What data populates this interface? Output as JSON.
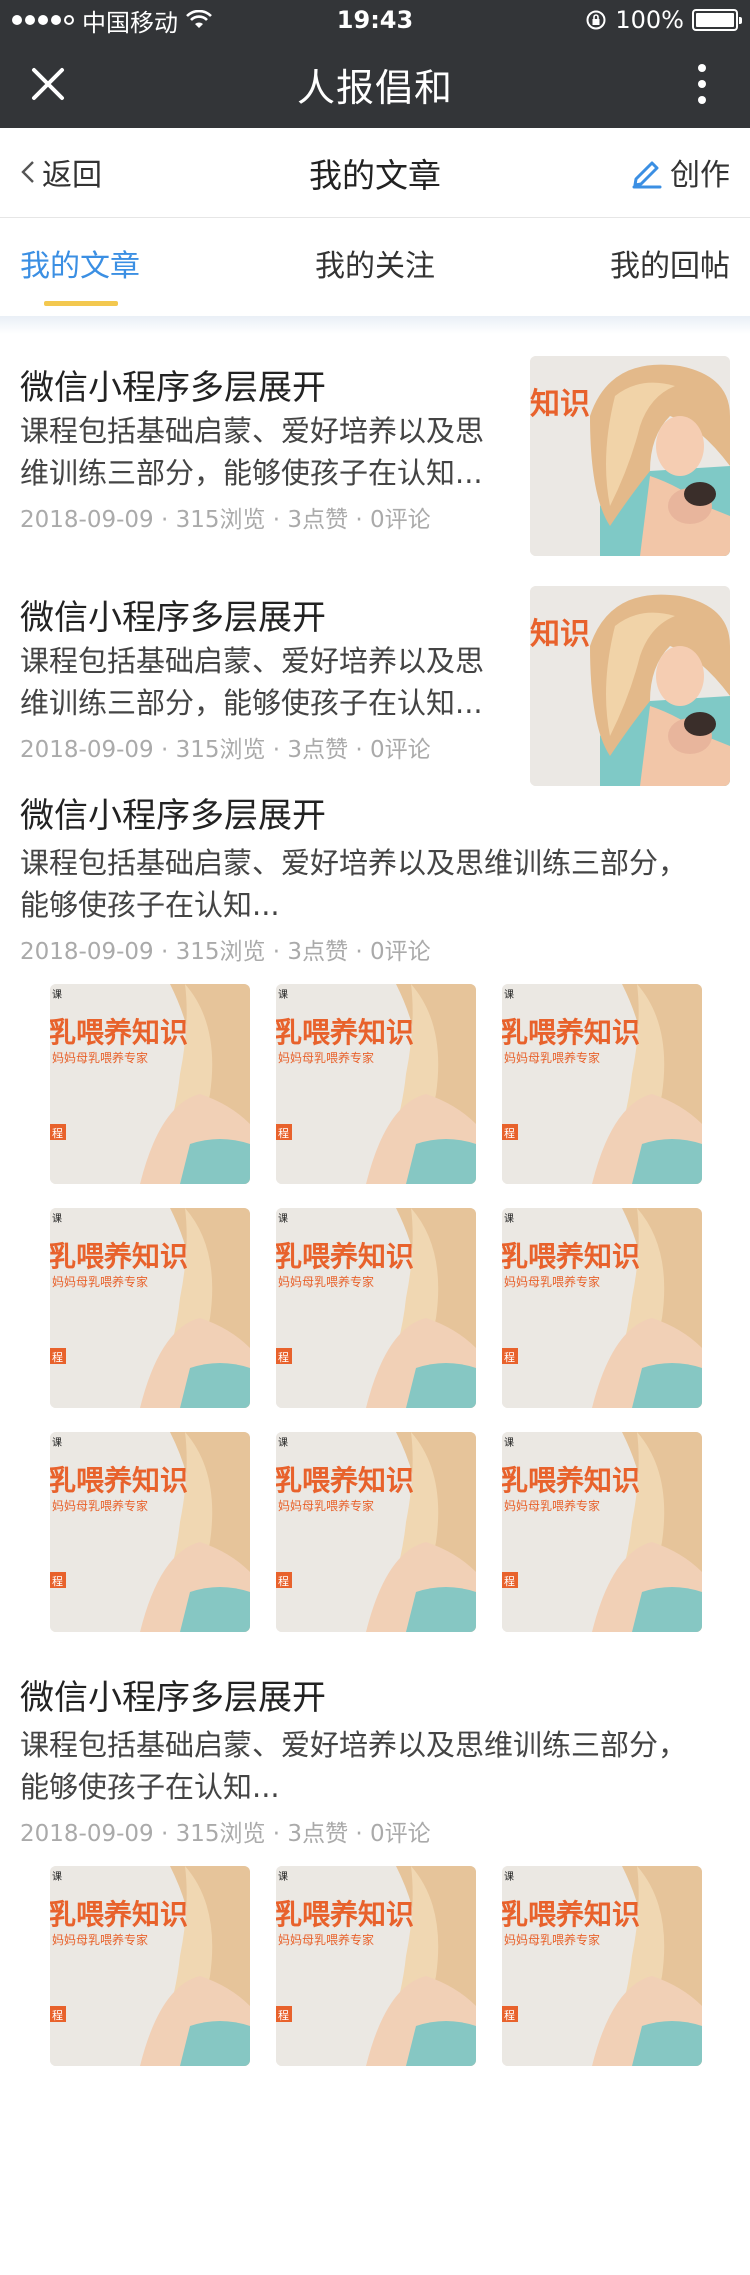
{
  "status_bar": {
    "carrier": "中国移动",
    "time": "19:43",
    "battery": "100%",
    "battery_level": 1.0
  },
  "app": {
    "title": "人报倡和"
  },
  "nav": {
    "back_label": "返回",
    "page_title": "我的文章",
    "create_label": "创作"
  },
  "tabs": [
    {
      "label": "我的文章",
      "active": true
    },
    {
      "label": "我的关注",
      "active": false
    },
    {
      "label": "我的回帖",
      "active": false
    }
  ],
  "colors": {
    "accent": "#3b8fe3",
    "tab_indicator": "#f3c84f",
    "header_bg": "#333538",
    "thumb_text": "#e8622c"
  },
  "thumb_single": {
    "text": "知识"
  },
  "thumb_grid": {
    "line1": "乳喂养知识",
    "line2": "妈妈母乳喂养专家",
    "tag": "程",
    "corner": "课"
  },
  "articles": [
    {
      "title": "微信小程序多层展开",
      "desc1": "课程包括基础启蒙、爱好培养以及思",
      "desc2": "维训练三部分，能够使孩子在认知...",
      "meta": "2018-09-09 · 315浏览 · 3点赞 · 0评论"
    },
    {
      "title": "微信小程序多层展开",
      "desc1": "课程包括基础启蒙、爱好培养以及思",
      "desc2": "维训练三部分，能够使孩子在认知...",
      "meta": "2018-09-09 · 315浏览 · 3点赞 · 0评论"
    },
    {
      "title": "微信小程序多层展开",
      "desc1": "课程包括基础启蒙、爱好培养以及思维训练三部分，",
      "desc2": "能够使孩子在认知...",
      "meta": "2018-09-09 · 315浏览 · 3点赞 · 0评论"
    },
    {
      "title": "微信小程序多层展开",
      "desc1": "课程包括基础启蒙、爱好培养以及思维训练三部分，",
      "desc2": "能够使孩子在认知...",
      "meta": "2018-09-09 · 315浏览 · 3点赞 · 0评论"
    }
  ]
}
